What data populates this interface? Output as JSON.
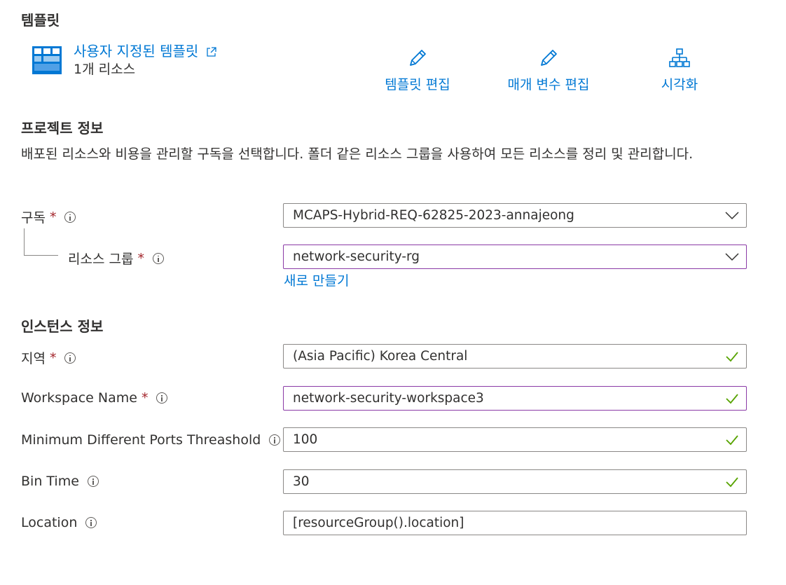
{
  "template": {
    "section_title": "템플릿",
    "link_label": "사용자 지정된 템플릿",
    "resource_count": "1개 리소스",
    "icon": "template-grid-icon",
    "actions": [
      {
        "label": "템플릿 편집",
        "icon": "pencil-icon"
      },
      {
        "label": "매개 변수 편집",
        "icon": "pencil-icon"
      },
      {
        "label": "시각화",
        "icon": "hierarchy-icon"
      }
    ]
  },
  "project": {
    "section_title": "프로젝트 정보",
    "description": "배포된 리소스와 비용을 관리할 구독을 선택합니다. 폴더 같은 리소스 그룹을 사용하여 모든 리소스를 정리 및 관리합니다.",
    "subscription": {
      "label": "구독",
      "required": "*",
      "value": "MCAPS-Hybrid-REQ-62825-2023-annajeong"
    },
    "resource_group": {
      "label": "리소스 그룹",
      "required": "*",
      "value": "network-security-rg",
      "create_new": "새로 만들기"
    }
  },
  "instance": {
    "section_title": "인스턴스 정보",
    "region": {
      "label": "지역",
      "required": "*",
      "value": "(Asia Pacific) Korea Central"
    },
    "workspace_name": {
      "label": "Workspace Name",
      "required": "*",
      "value": "network-security-workspace3"
    },
    "min_ports": {
      "label": "Minimum Different Ports Threashold",
      "value": "100"
    },
    "bin_time": {
      "label": "Bin Time",
      "value": "30"
    },
    "location": {
      "label": "Location",
      "value": "[resourceGroup().location]"
    }
  },
  "colors": {
    "link": "#0078d4",
    "required": "#a4262c",
    "valid_check": "#57a300",
    "focus_border": "#8a3aa6"
  }
}
